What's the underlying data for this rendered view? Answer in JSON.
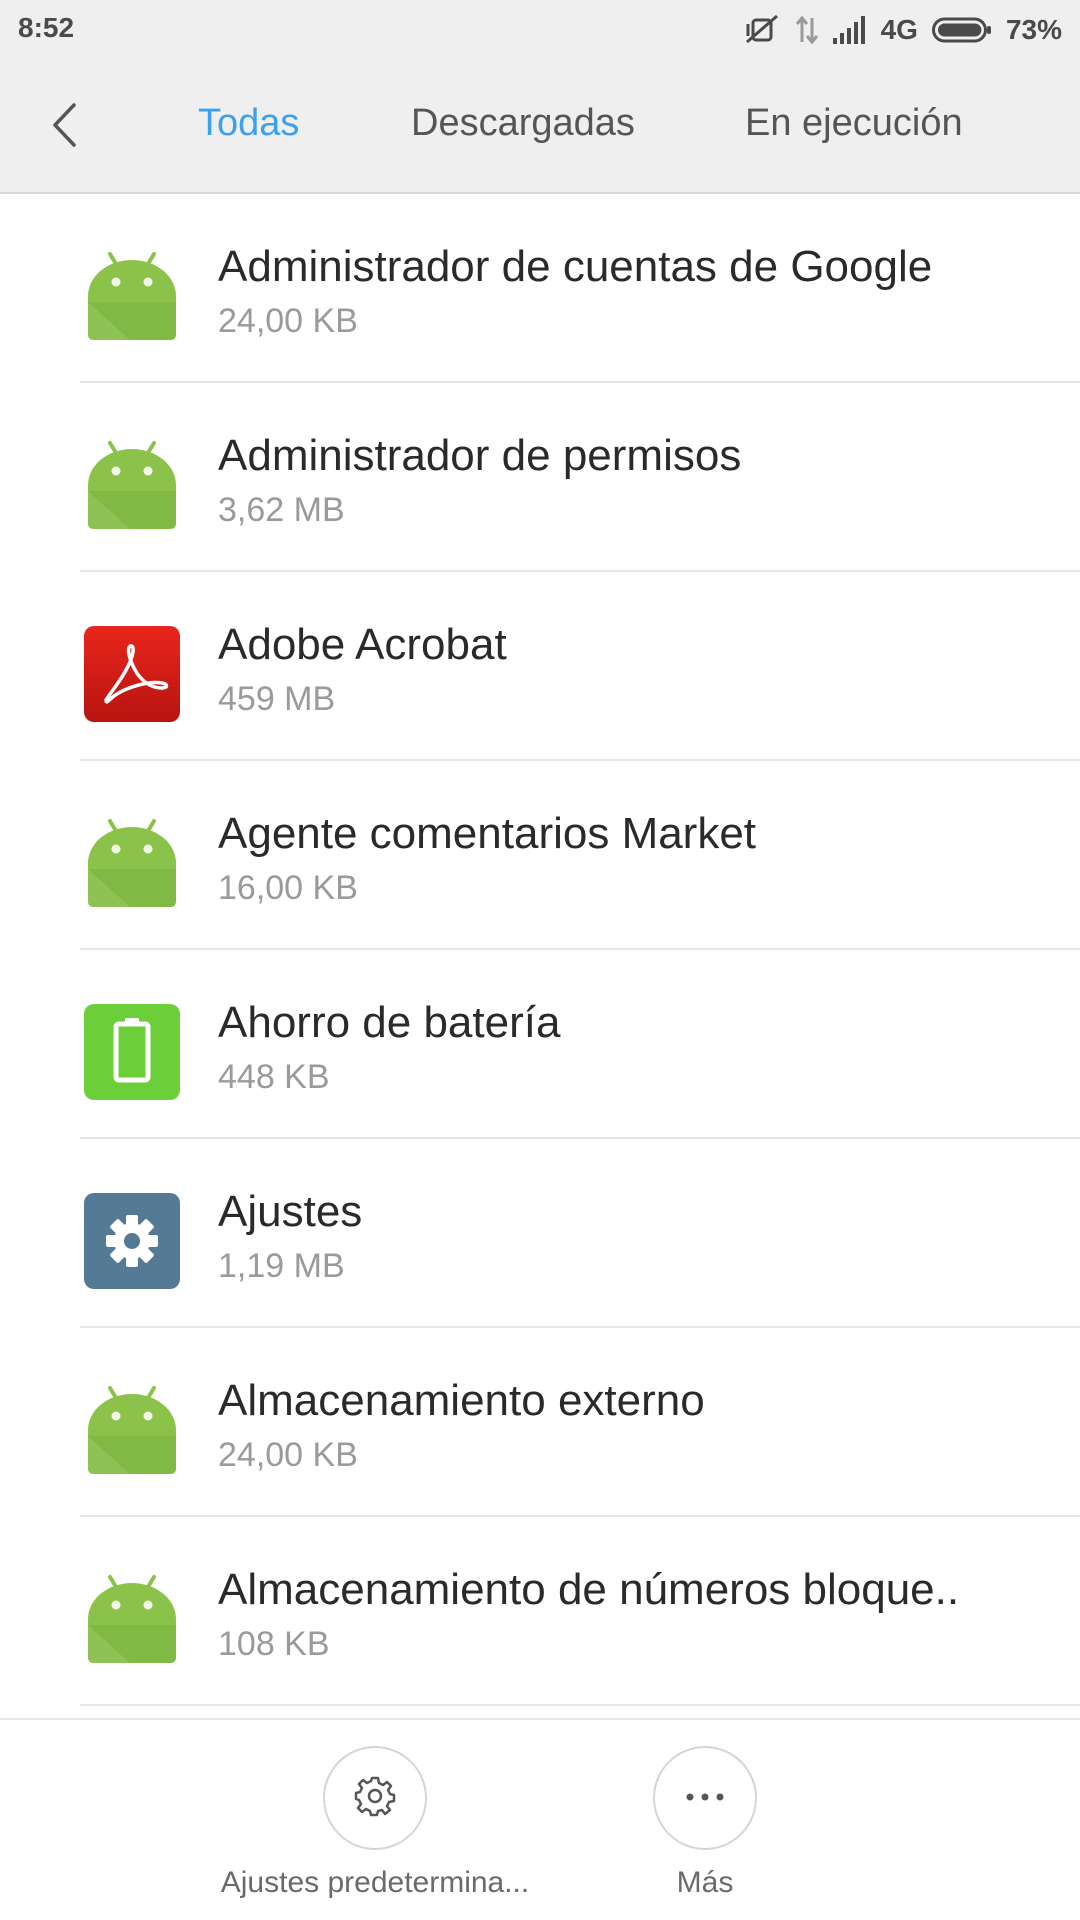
{
  "status_bar": {
    "time": "8:52",
    "network": "4G",
    "battery": "73%",
    "battery_level": 0.73,
    "icons": [
      "vibrate-off-icon",
      "data-arrows-icon",
      "signal-icon",
      "battery-icon"
    ]
  },
  "header": {
    "back_icon": "chevron-left-icon",
    "tabs": [
      {
        "label": "Todas",
        "active": true
      },
      {
        "label": "Descargadas",
        "active": false
      },
      {
        "label": "En ejecución",
        "active": false
      }
    ]
  },
  "apps": [
    {
      "name": "Administrador de cuentas de Google",
      "size": "24,00 KB",
      "icon": "android-icon"
    },
    {
      "name": "Administrador de permisos",
      "size": "3,62 MB",
      "icon": "android-icon"
    },
    {
      "name": "Adobe Acrobat",
      "size": "459 MB",
      "icon": "acrobat-icon"
    },
    {
      "name": "Agente comentarios Market",
      "size": "16,00 KB",
      "icon": "android-icon"
    },
    {
      "name": "Ahorro de batería",
      "size": "448 KB",
      "icon": "battery-saver-icon"
    },
    {
      "name": "Ajustes",
      "size": "1,19 MB",
      "icon": "settings-gear-icon"
    },
    {
      "name": "Almacenamiento externo",
      "size": "24,00 KB",
      "icon": "android-icon"
    },
    {
      "name": "Almacenamiento de números bloque..",
      "size": "108 KB",
      "icon": "android-icon"
    }
  ],
  "bottom_bar": {
    "default_settings_label": "Ajustes predetermina...",
    "more_label": "Más"
  },
  "colors": {
    "accent": "#3ba1ee",
    "android_green": "#8bc34a",
    "acrobat_red": "#d21f17",
    "battery_green": "#6ccf3a",
    "settings_blue": "#557a96"
  }
}
